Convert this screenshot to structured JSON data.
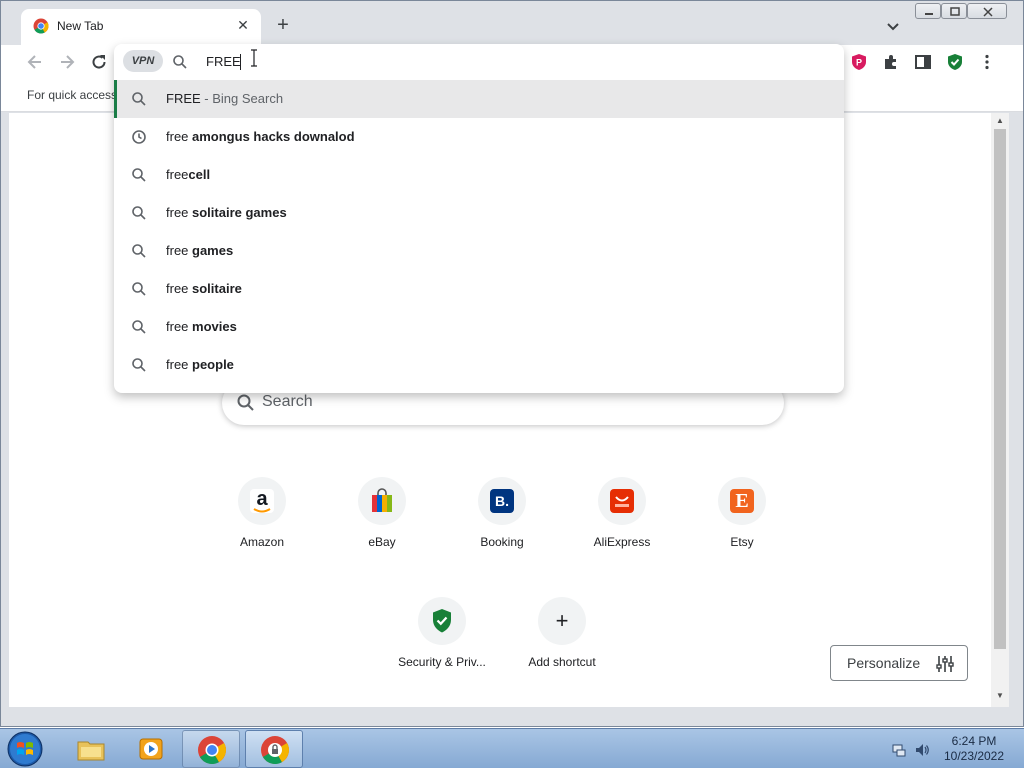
{
  "tab": {
    "title": "New Tab"
  },
  "bookmarks": {
    "text": "For quick access"
  },
  "omnibox": {
    "vpn_label": "VPN",
    "input_value": "FREE",
    "suggestions": [
      {
        "icon": "search-icon",
        "plain": "FREE",
        "bold": "",
        "hint": " - Bing Search"
      },
      {
        "icon": "history-icon",
        "plain": "free ",
        "bold": "amongus hacks downalod",
        "hint": ""
      },
      {
        "icon": "search-icon",
        "plain": "free",
        "bold": "cell",
        "hint": ""
      },
      {
        "icon": "search-icon",
        "plain": "free ",
        "bold": "solitaire games",
        "hint": ""
      },
      {
        "icon": "search-icon",
        "plain": "free ",
        "bold": "games",
        "hint": ""
      },
      {
        "icon": "search-icon",
        "plain": "free ",
        "bold": "solitaire",
        "hint": ""
      },
      {
        "icon": "search-icon",
        "plain": "free ",
        "bold": "movies",
        "hint": ""
      },
      {
        "icon": "search-icon",
        "plain": "free ",
        "bold": "people",
        "hint": ""
      }
    ]
  },
  "page": {
    "search_label": "Search",
    "shortcuts": [
      {
        "label": "Amazon",
        "glyph": "a",
        "color": "#ffffff",
        "fg": "#131921"
      },
      {
        "label": "eBay",
        "glyph": "",
        "color": "#e53238",
        "fg": "#ffffff"
      },
      {
        "label": "Booking",
        "glyph": "B.",
        "color": "#003580",
        "fg": "#ffffff"
      },
      {
        "label": "AliExpress",
        "glyph": "",
        "color": "#e62e04",
        "fg": "#ffffff"
      },
      {
        "label": "Etsy",
        "glyph": "E",
        "color": "#f1641e",
        "fg": "#ffffff"
      },
      {
        "label": "Security & Priv...",
        "glyph": "",
        "color": "#188038",
        "fg": "#ffffff"
      },
      {
        "label": "Add shortcut",
        "glyph": "+",
        "color": "#f1f3f4",
        "fg": "#202124"
      }
    ],
    "personalize_label": "Personalize"
  },
  "taskbar": {
    "time": "6:24 PM",
    "date": "10/23/2022"
  },
  "colors": {
    "selected_bar": "#1a7d47",
    "extension_red": "#d81b60",
    "extension_green": "#188038"
  }
}
